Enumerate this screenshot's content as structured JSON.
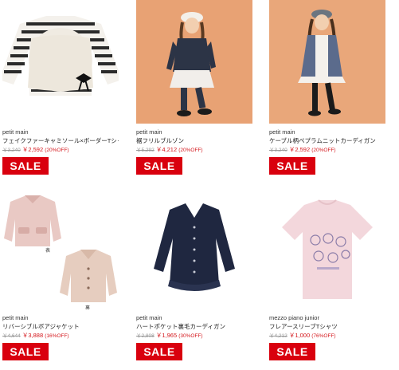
{
  "products": [
    {
      "brand": "petit main",
      "name": "フェイクファーキャミソール×ボーダーTシャツセット",
      "orig_price": "￥3,240",
      "sale_price": "￥2,592",
      "discount": "(20%OFF)",
      "badge": "SALE",
      "image": "striped-shirt-with-fur-camisole"
    },
    {
      "brand": "petit main",
      "name": "裾フリルブルゾン",
      "orig_price": "￥5,292",
      "sale_price": "￥4,212",
      "discount": "(20%OFF)",
      "badge": "SALE",
      "image": "girl-in-navy-quilted-jacket"
    },
    {
      "brand": "petit main",
      "name": "ケーブル柄ペプラムニットカーディガン",
      "orig_price": "￥3,240",
      "sale_price": "￥2,592",
      "discount": "(20%OFF)",
      "badge": "SALE",
      "image": "girl-in-blue-cable-cardigan"
    },
    {
      "brand": "petit main",
      "name": "リバーシブルボアジャケット",
      "orig_price": "￥4,644",
      "sale_price": "￥3,888",
      "discount": "(16%OFF)",
      "badge": "SALE",
      "image": "reversible-boa-jacket",
      "labels": [
        "表",
        "裏"
      ]
    },
    {
      "brand": "petit main",
      "name": "ハートポケット裏毛カーディガン",
      "orig_price": "￥2,808",
      "sale_price": "￥1,965",
      "discount": "(30%OFF)",
      "badge": "SALE",
      "image": "navy-heart-pocket-cardigan"
    },
    {
      "brand": "mezzo piano junior",
      "name": "フレアースリーブTシャツ",
      "orig_price": "￥4,212",
      "sale_price": "￥1,000",
      "discount": "(76%OFF)",
      "badge": "SALE",
      "image": "pink-flare-sleeve-tshirt"
    }
  ],
  "colors": {
    "sale_badge": "#d9000e",
    "sale_price": "#d4161b",
    "orig_price": "#999999"
  }
}
